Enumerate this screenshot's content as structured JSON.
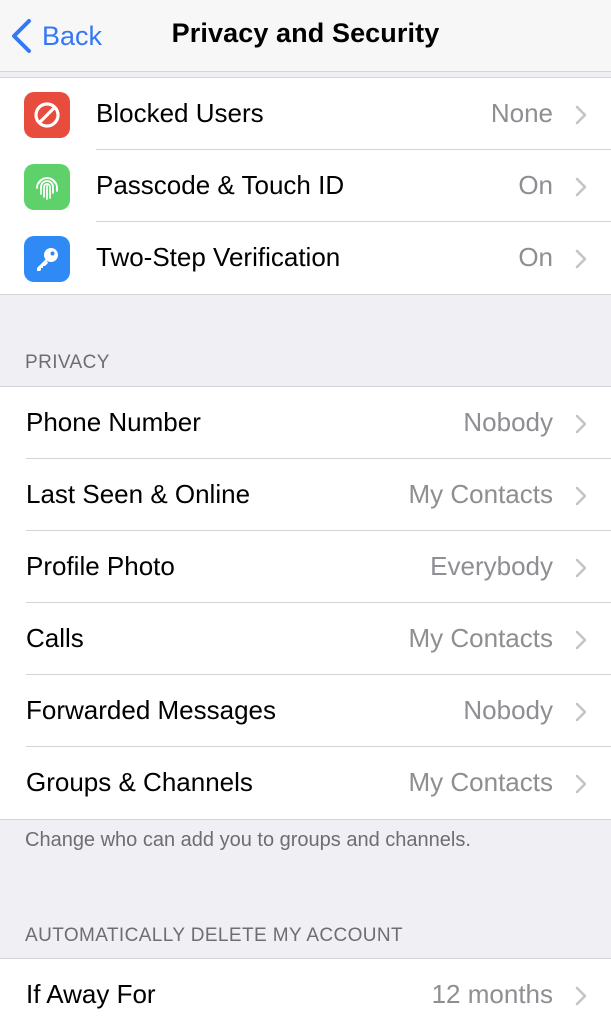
{
  "nav": {
    "back_label": "Back",
    "title": "Privacy and Security"
  },
  "security": {
    "items": [
      {
        "label": "Blocked Users",
        "value": "None",
        "icon": "blocked-icon",
        "color": "#e74c3c"
      },
      {
        "label": "Passcode & Touch ID",
        "value": "On",
        "icon": "fingerprint-icon",
        "color": "#5ed16a"
      },
      {
        "label": "Two-Step Verification",
        "value": "On",
        "icon": "key-icon",
        "color": "#2f8af5"
      }
    ]
  },
  "privacy": {
    "header": "PRIVACY",
    "items": [
      {
        "label": "Phone Number",
        "value": "Nobody"
      },
      {
        "label": "Last Seen & Online",
        "value": "My Contacts"
      },
      {
        "label": "Profile Photo",
        "value": "Everybody"
      },
      {
        "label": "Calls",
        "value": "My Contacts"
      },
      {
        "label": "Forwarded Messages",
        "value": "Nobody"
      },
      {
        "label": "Groups & Channels",
        "value": "My Contacts"
      }
    ],
    "footer": "Change who can add you to groups and channels."
  },
  "account": {
    "header": "AUTOMATICALLY DELETE MY ACCOUNT",
    "items": [
      {
        "label": "If Away For",
        "value": "12 months"
      }
    ]
  },
  "colors": {
    "accent": "#3478f6",
    "secondary_text": "#8e8e93",
    "background": "#efeff4"
  }
}
